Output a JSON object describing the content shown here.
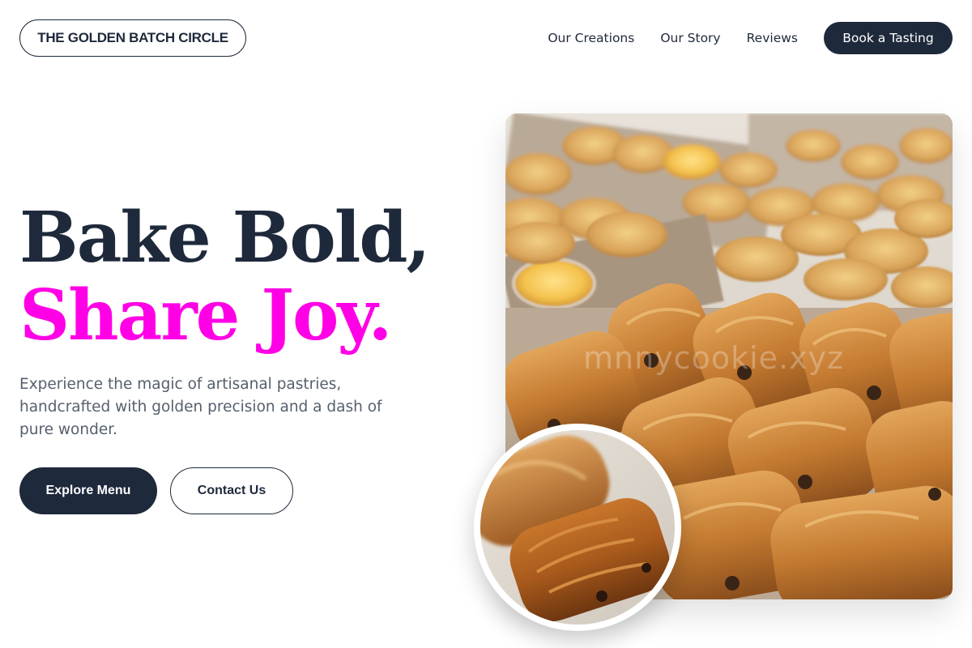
{
  "header": {
    "brand": "THE GOLDEN BATCH CIRCLE",
    "nav": [
      {
        "label": "Our Creations"
      },
      {
        "label": "Our Story"
      },
      {
        "label": "Reviews"
      }
    ],
    "cta_label": "Book a Tasting"
  },
  "hero": {
    "title_line1": "Bake Bold,",
    "title_line2": "Share Joy.",
    "description": "Experience the magic of artisanal pastries, handcrafted with golden precision and a dash of pure wonder.",
    "primary_button": "Explore Menu",
    "secondary_button": "Contact Us"
  },
  "media": {
    "main_image_watermark": "mnnycookie.xyz",
    "main_image_subject": "pastry-tray-photo",
    "inset_image_subject": "croissant-closeup-photo"
  },
  "colors": {
    "primary": "#1e293b",
    "accent": "#ff00e6",
    "muted_text": "#555f6c",
    "background": "#ffffff"
  }
}
